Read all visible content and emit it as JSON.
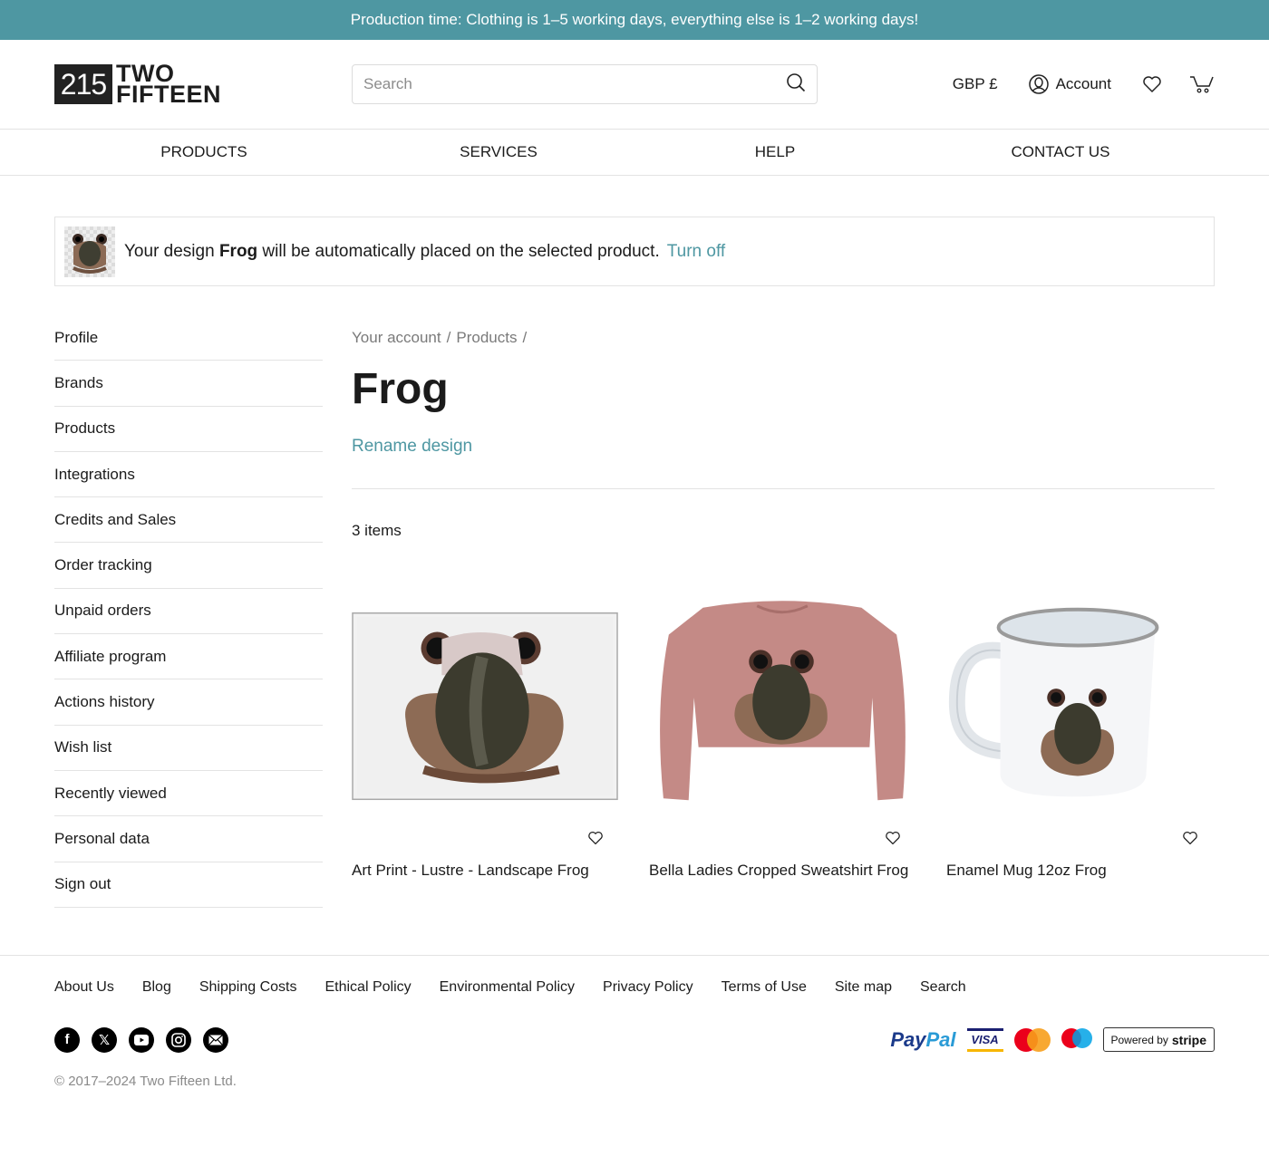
{
  "promo": {
    "text": "Production time: Clothing is 1–5 working days, everything else is 1–2 working days!"
  },
  "header": {
    "logo_mark": "215",
    "logo_line1": "TWO",
    "logo_line2": "FIFTEEN",
    "search_placeholder": "Search",
    "search_value": "",
    "currency": "GBP £",
    "account_label": "Account",
    "icons": {
      "search": "search-icon",
      "account": "user-circle-icon",
      "wishlist": "heart-icon",
      "cart": "cart-icon"
    }
  },
  "nav": {
    "items": [
      {
        "label": "PRODUCTS"
      },
      {
        "label": "SERVICES"
      },
      {
        "label": "HELP"
      },
      {
        "label": "CONTACT US"
      }
    ]
  },
  "notice": {
    "prefix": "Your design ",
    "design_name": "Frog",
    "suffix": " will be automatically placed on the selected product.",
    "action": "Turn off"
  },
  "sidebar": {
    "items": [
      {
        "label": "Profile"
      },
      {
        "label": "Brands"
      },
      {
        "label": "Products"
      },
      {
        "label": "Integrations"
      },
      {
        "label": "Credits and Sales"
      },
      {
        "label": "Order tracking"
      },
      {
        "label": "Unpaid orders"
      },
      {
        "label": "Affiliate program"
      },
      {
        "label": "Actions history"
      },
      {
        "label": "Wish list"
      },
      {
        "label": "Recently viewed"
      },
      {
        "label": "Personal data"
      },
      {
        "label": "Sign out"
      }
    ]
  },
  "main": {
    "breadcrumb": [
      {
        "label": "Your account"
      },
      {
        "label": "Products"
      }
    ],
    "breadcrumb_sep": "/",
    "title": "Frog",
    "rename_label": "Rename design",
    "item_count": "3 items",
    "products": [
      {
        "name": "Art Print - Lustre - Landscape Frog",
        "image": "art-print-frog"
      },
      {
        "name": "Bella Ladies Cropped Sweatshirt Frog",
        "image": "cropped-sweatshirt-frog"
      },
      {
        "name": "Enamel Mug 12oz Frog",
        "image": "enamel-mug-frog"
      }
    ]
  },
  "footer": {
    "links": [
      {
        "label": "About Us"
      },
      {
        "label": "Blog"
      },
      {
        "label": "Shipping Costs"
      },
      {
        "label": "Ethical Policy"
      },
      {
        "label": "Environmental Policy"
      },
      {
        "label": "Privacy Policy"
      },
      {
        "label": "Terms of Use"
      },
      {
        "label": "Site map"
      },
      {
        "label": "Search"
      }
    ],
    "social": [
      "facebook-icon",
      "x-icon",
      "youtube-icon",
      "instagram-icon",
      "email-icon"
    ],
    "payments": {
      "paypal_a": "Pay",
      "paypal_b": "Pal",
      "visa": "VISA",
      "maestro": "maestro",
      "stripe_prefix": "Powered by",
      "stripe_brand": "stripe"
    },
    "copyright": "© 2017–2024 Two Fifteen Ltd."
  },
  "colors": {
    "accent": "#4e97a2",
    "text": "#1b1b1b",
    "muted": "#7a7a7a",
    "border": "#e3e3e3"
  }
}
